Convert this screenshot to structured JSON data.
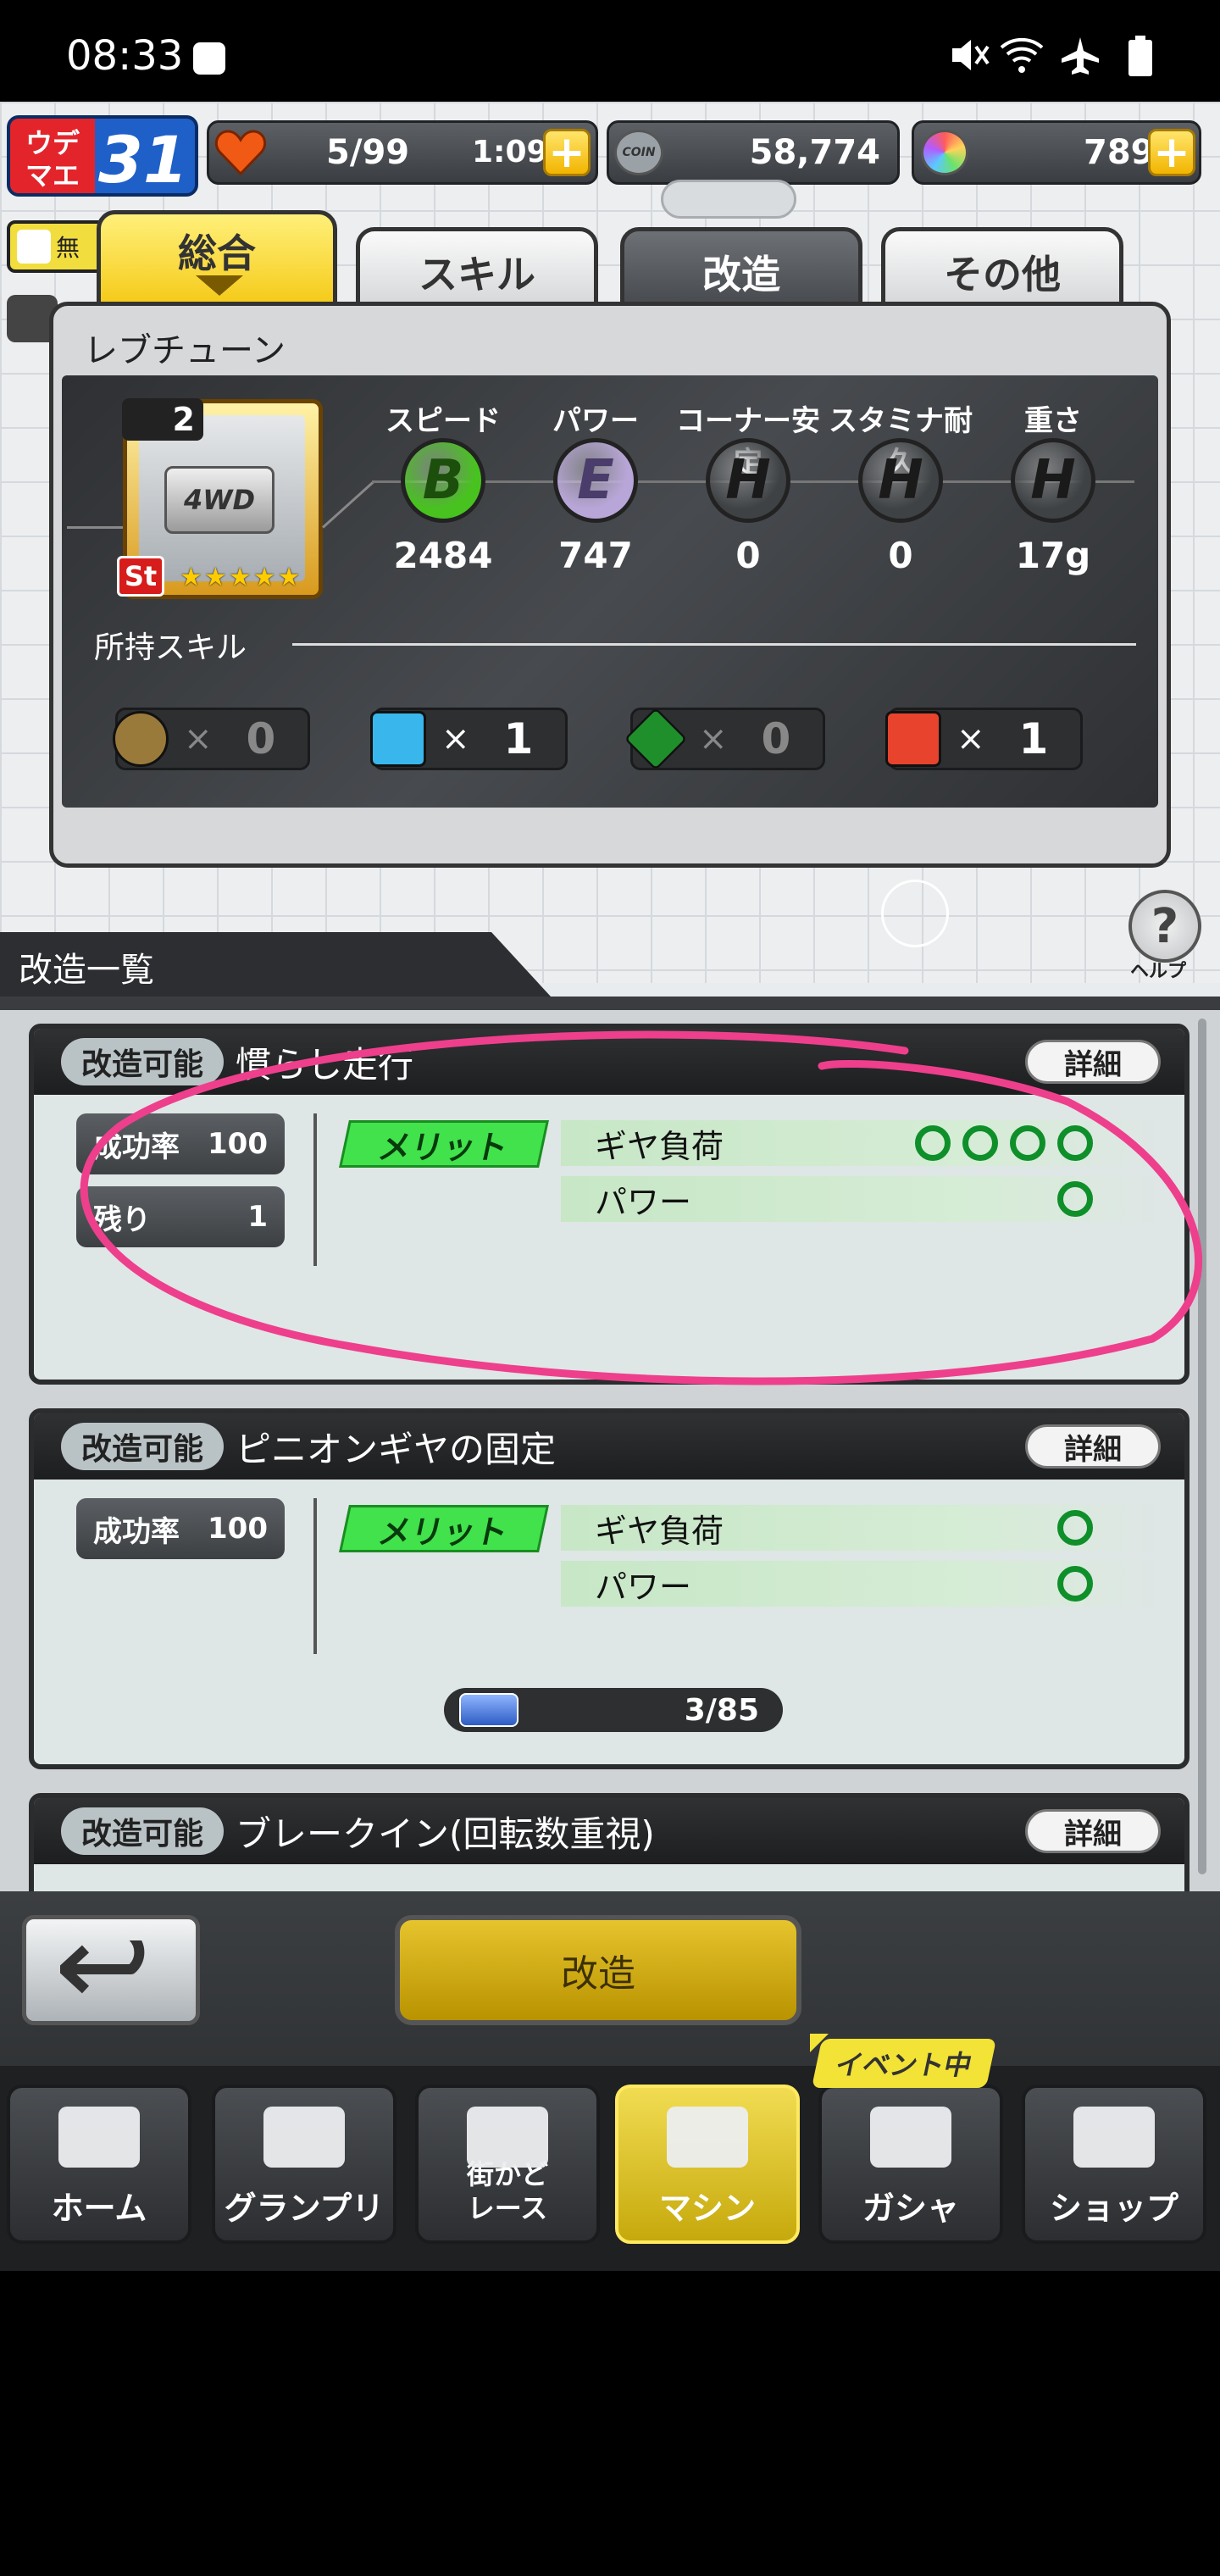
{
  "status_bar": {
    "time": "08:33",
    "icons": [
      "settings-icon",
      "mute-icon",
      "wifi-icon",
      "airplane-icon",
      "battery-icon"
    ]
  },
  "header": {
    "udemae_label": "ウデ\nマエ",
    "udemae_value": "31",
    "hearts": "5/99",
    "timer": "1:09",
    "coin_label": "COIN",
    "coins": "58,774",
    "gems": "789"
  },
  "notice_stub": "無",
  "tabs": [
    {
      "label": "総合",
      "active": true
    },
    {
      "label": "スキル",
      "active": false
    },
    {
      "label": "改造",
      "active": false
    },
    {
      "label": "その他",
      "active": false
    }
  ],
  "part_panel": {
    "title": "レブチューン",
    "part_count": "2",
    "part_brand": "4WD",
    "part_badge": "St",
    "stars": "★★★★★",
    "stats": [
      {
        "label": "スピード",
        "rank": "B",
        "value": "2484",
        "color": "#48c21f"
      },
      {
        "label": "パワー",
        "rank": "E",
        "value": "747",
        "color": "#b9a6d9"
      },
      {
        "label": "コーナー安定",
        "rank": "H",
        "value": "0",
        "color": "#3f4244"
      },
      {
        "label": "スタミナ耐久",
        "rank": "H",
        "value": "0",
        "color": "#3f4244"
      },
      {
        "label": "重さ",
        "rank": "H",
        "value": "17g",
        "color": "#3f4244"
      }
    ],
    "skills_label": "所持スキル",
    "skills": [
      {
        "icon": "star-skill-icon",
        "count": "0"
      },
      {
        "icon": "blue-up-arrow-icon",
        "count": "1"
      },
      {
        "icon": "green-diamond-icon",
        "count": "0"
      },
      {
        "icon": "red-down-arrow-icon",
        "count": "1"
      }
    ],
    "times": "×"
  },
  "help_label": "ヘルプ",
  "section_title": "改造一覧",
  "mods": [
    {
      "status": "改造可能",
      "title": "慣らし走行",
      "detail": "詳細",
      "success_label": "成功率",
      "success_value": "100",
      "remaining_label": "残り",
      "remaining_value": "1",
      "merit": "メリット",
      "effects": [
        {
          "name": "ギヤ負荷",
          "circles": 4
        },
        {
          "name": "パワー",
          "circles": 1
        }
      ]
    },
    {
      "status": "改造可能",
      "title": "ピニオンギヤの固定",
      "detail": "詳細",
      "success_label": "成功率",
      "success_value": "100",
      "merit": "メリット",
      "effects": [
        {
          "name": "ギヤ負荷",
          "circles": 1
        },
        {
          "name": "パワー",
          "circles": 1
        }
      ],
      "material": "3/85",
      "material_fraction": 0.035
    },
    {
      "status": "改造可能",
      "title": "ブレークイン(回転数重視)",
      "detail": "詳細"
    }
  ],
  "action_button": "改造",
  "event_label": "イベント中",
  "nav": [
    {
      "label": "ホーム",
      "icon": "toolbox-icon"
    },
    {
      "label": "グランプリ",
      "icon": "checkered-flag-icon"
    },
    {
      "label": "街かど\nレース",
      "icon": "people-racing-icon"
    },
    {
      "label": "マシン",
      "icon": "car-icon"
    },
    {
      "label": "ガシャ",
      "icon": "star-laurel-icon"
    },
    {
      "label": "ショップ",
      "icon": "building-icon"
    }
  ]
}
